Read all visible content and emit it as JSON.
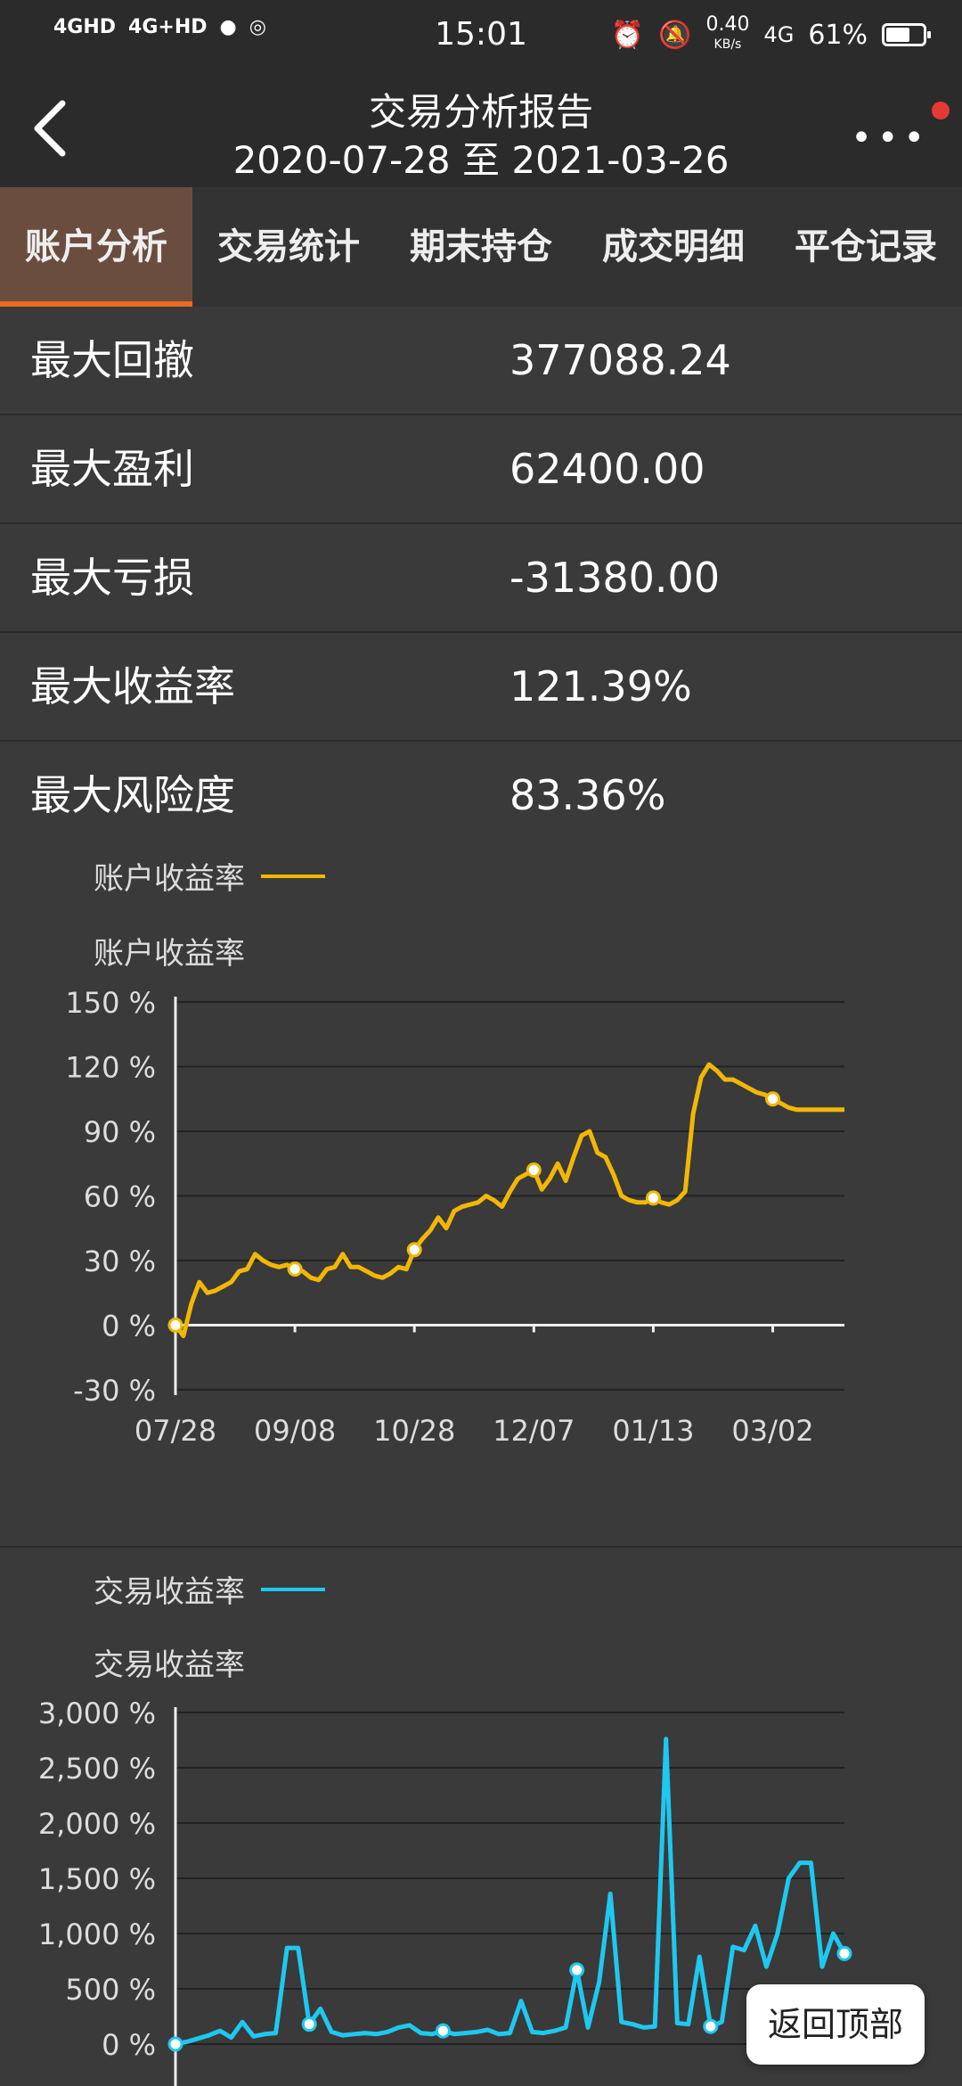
{
  "status": {
    "time": "15:01",
    "net1": "4GHD",
    "net2": "4G+HD",
    "speed": "0.40",
    "speed_unit": "KB/s",
    "net3": "4G",
    "battery": "61%"
  },
  "header": {
    "title": "交易分析报告",
    "date_range": "2020-07-28 至 2021-03-26"
  },
  "tabs": [
    {
      "label": "账户分析"
    },
    {
      "label": "交易统计"
    },
    {
      "label": "期末持仓"
    },
    {
      "label": "成交明细"
    },
    {
      "label": "平仓记录"
    }
  ],
  "stats": [
    {
      "label": "最大回撤",
      "value": "377088.24"
    },
    {
      "label": "最大盈利",
      "value": "62400.00"
    },
    {
      "label": "最大亏损",
      "value": "-31380.00"
    },
    {
      "label": "最大收益率",
      "value": "121.39%"
    },
    {
      "label": "最大风险度",
      "value": "83.36%"
    }
  ],
  "chart_data": [
    {
      "type": "line",
      "legend": "账户收益率",
      "title": "账户收益率",
      "color": "#f2b705",
      "xticks": [
        "07/28",
        "09/08",
        "10/28",
        "12/07",
        "01/13",
        "03/02"
      ],
      "yticks": [
        "150 %",
        "120 %",
        "90 %",
        "60 %",
        "30 %",
        "0 %",
        "-30 %"
      ],
      "ylim": [
        -30,
        150
      ],
      "x": [
        0,
        2,
        4,
        6,
        8,
        10,
        12,
        14,
        16,
        18,
        20,
        22,
        24,
        26,
        28,
        30,
        32,
        34,
        36,
        38,
        40,
        42,
        44,
        46,
        48,
        50,
        52,
        54,
        56,
        58,
        60,
        62,
        64,
        66,
        68,
        70,
        72,
        74,
        76,
        78,
        80,
        82,
        84,
        86,
        88,
        90,
        92,
        94,
        96,
        98,
        100,
        102,
        104,
        106,
        108,
        110,
        112,
        114,
        116,
        118,
        120,
        122,
        124,
        126,
        128,
        130,
        132,
        134,
        136,
        138,
        140,
        142,
        144,
        146,
        148,
        150,
        152,
        154,
        156,
        158,
        160,
        162,
        164,
        166,
        168
      ],
      "values": [
        0,
        -5,
        10,
        20,
        15,
        16,
        18,
        20,
        25,
        26,
        33,
        30,
        28,
        27,
        28,
        26,
        25,
        22,
        21,
        26,
        27,
        33,
        27,
        27,
        25,
        23,
        22,
        24,
        27,
        26,
        35,
        40,
        44,
        50,
        45,
        53,
        55,
        56,
        57,
        60,
        58,
        55,
        62,
        68,
        70,
        72,
        63,
        68,
        75,
        67,
        78,
        88,
        90,
        80,
        78,
        70,
        60,
        58,
        57,
        57,
        59,
        57,
        56,
        58,
        62,
        98,
        115,
        121,
        118,
        114,
        114,
        112,
        110,
        108,
        107,
        105,
        103,
        101,
        100,
        100,
        100,
        100,
        100,
        100,
        100
      ],
      "markers": [
        0,
        30,
        60,
        90,
        120,
        150
      ]
    },
    {
      "type": "line",
      "legend": "交易收益率",
      "title": "交易收益率",
      "color": "#1ec8f0",
      "yticks": [
        "3,000 %",
        "2,500 %",
        "2,000 %",
        "1,500 %",
        "1,000 %",
        "500 %",
        "0 %"
      ],
      "ylim": [
        0,
        3000
      ],
      "values": [
        0,
        20,
        50,
        80,
        120,
        60,
        200,
        70,
        90,
        100,
        870,
        870,
        180,
        320,
        110,
        80,
        90,
        100,
        90,
        110,
        150,
        170,
        100,
        90,
        120,
        90,
        100,
        110,
        130,
        90,
        100,
        390,
        110,
        100,
        120,
        150,
        670,
        150,
        560,
        1360,
        200,
        180,
        150,
        160,
        2760,
        190,
        180,
        790,
        160,
        200,
        880,
        850,
        1070,
        700,
        1000,
        1500,
        1640,
        1640,
        700,
        1000,
        820
      ]
    }
  ],
  "back_to_top": "返回顶部"
}
